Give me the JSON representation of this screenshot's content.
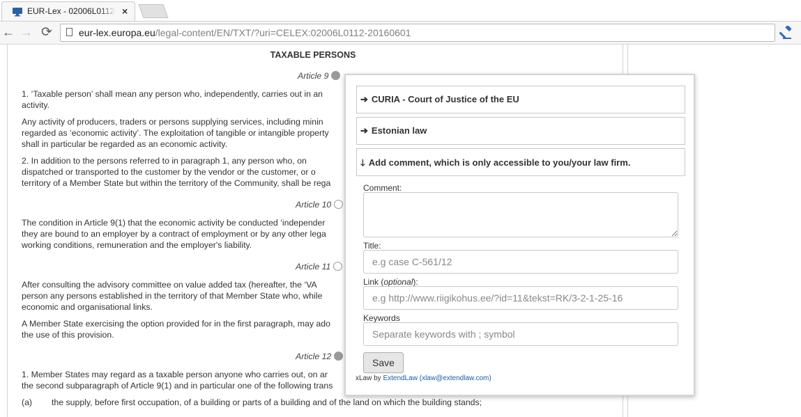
{
  "browser": {
    "tab_title": "EUR-Lex - 02006L0112-2",
    "tab_close": "×",
    "url_host": "eur-lex.europa.eu",
    "url_path": "/legal-content/EN/TXT/?uri=CELEX:02006L0112-20160601",
    "icons": {
      "back": "←",
      "forward": "→",
      "reload": "⟳"
    }
  },
  "document": {
    "heading": "TAXABLE PERSONS",
    "art9": {
      "label": "Article 9",
      "p1a": "1.  ‘Taxable person’ shall mean any person who, independently, carries out in an",
      "p1b": "activity.",
      "p2a": "Any activity of producers, traders or persons supplying services, including minin",
      "p2b": "regarded as ‘economic activity’. The exploitation of tangible or intangible property",
      "p2c": "shall in particular be regarded as an economic activity.",
      "p3a": "2.  In addition to the persons referred to in paragraph 1, any person who, on",
      "p3b": "dispatched or transported to the customer by the vendor or the customer, or o",
      "p3c": "territory of a Member State but within the territory of the Community, shall be rega"
    },
    "art10": {
      "label": "Article 10",
      "p1a": "The condition in Article 9(1) that the economic activity be conducted ‘independer",
      "p1b": "they are bound to an employer by a contract of employment or by any other lega",
      "p1c": "working conditions, remuneration and the employer's liability."
    },
    "art11": {
      "label": "Article 11",
      "p1a": "After consulting the advisory committee on value added tax (hereafter, the ‘VA",
      "p1b": "person any persons established in the territory of that Member State who, while",
      "p1c": "economic and organisational links.",
      "p2a": "A Member State exercising the option provided for in the first paragraph, may ado",
      "p2b": "the use of this provision."
    },
    "art12": {
      "label": "Article 12",
      "p1a": "1.  Member States may regard as a taxable person anyone who carries out, on ar",
      "p1b": "the second subparagraph of Article 9(1) and in particular one of the following trans",
      "item_a_marker": "(a)",
      "item_a_text": "the supply, before first occupation, of a building or parts of a building and of the land on which the building stands;"
    }
  },
  "popup": {
    "accordion": [
      {
        "arrow": "➔",
        "label": "CURIA - Court of Justice of the EU"
      },
      {
        "arrow": "➔",
        "label": "Estonian law"
      },
      {
        "arrow": "🡓",
        "label": "Add comment, which is only accessible to you/your law firm."
      }
    ],
    "comment_label": "Comment:",
    "title_label": "Title:",
    "title_placeholder": "e.g case C-561/12",
    "link_label_pre": "Link (",
    "link_label_em": "optional",
    "link_label_post": "):",
    "link_placeholder": "e.g http://www.riigikohus.ee/?id=11&tekst=RK/3-2-1-25-16",
    "keywords_label": "Keywords",
    "keywords_placeholder": "Separate keywords with ; symbol",
    "save_label": "Save",
    "credit_pre": "xLaw by ",
    "credit_link1": "ExtendLaw",
    "credit_link2": "(xlaw@extendlaw.com)"
  }
}
